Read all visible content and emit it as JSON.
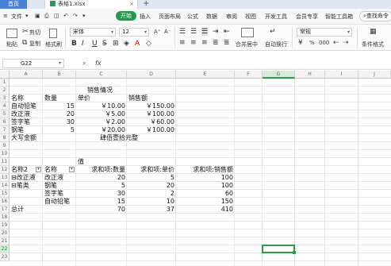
{
  "tabs": {
    "home": "首页",
    "file": "表格1.xlsx",
    "close": "×",
    "new": "+"
  },
  "menu": {
    "file_menu": "文件",
    "items": [
      "开始",
      "插入",
      "页面布局",
      "公式",
      "数据",
      "审阅",
      "视图",
      "开发工具",
      "会员专享",
      "智能工具箱"
    ],
    "search": "查找命令"
  },
  "ribbon": {
    "cut": "剪切",
    "copy": "复制",
    "format_painter": "格式刷",
    "paste": "粘贴",
    "font_name": "宋体",
    "font_size": "12",
    "font_grow": "A⁺",
    "font_shrink": "A⁻",
    "bold": "B",
    "italic": "I",
    "underline": "U",
    "font_color": "A",
    "merge_center": "合并居中",
    "auto_wrap": "自动换行",
    "number_format": "常规",
    "percent": "%",
    "thousands": "000",
    "cond_format": "条件格式"
  },
  "formula": {
    "cell_ref": "G22",
    "fx": "fx",
    "search_icon": "search-icon"
  },
  "columns": [
    "A",
    "B",
    "C",
    "D",
    "E",
    "F",
    "G",
    "H",
    "I",
    "J"
  ],
  "selected_col": "G",
  "rows": [
    "1",
    "2",
    "3",
    "4",
    "5",
    "6",
    "7",
    "8",
    "9",
    "10",
    "11",
    "12",
    "13",
    "14",
    "15",
    "16",
    "17",
    "18",
    "19",
    "20",
    "21",
    "22",
    "23"
  ],
  "selected_row": "22",
  "table1": {
    "title": "销售情况",
    "headers": [
      "名称",
      "数量",
      "单价",
      "销售额"
    ],
    "rows": [
      [
        "自动铅笔",
        "15",
        "￥10.00",
        "￥150.00"
      ],
      [
        "改正液",
        "20",
        "￥5.00",
        "￥100.00"
      ],
      [
        "签字笔",
        "30",
        "￥2.00",
        "￥60.00"
      ],
      [
        "钢笔",
        "5",
        "￥20.00",
        "￥100.00"
      ]
    ],
    "upper_label": "大写金额",
    "upper_value": "肆佰壹拾元整"
  },
  "pivot": {
    "value_label": "值",
    "headers": [
      "名称2",
      "名称",
      "求和项:数量",
      "求和项:单价",
      "求和项:销售额"
    ],
    "rows": [
      [
        "⊟改正液",
        "改正液",
        "20",
        "5",
        "100"
      ],
      [
        "⊟笔类",
        "钢笔",
        "5",
        "20",
        "100"
      ],
      [
        "",
        "签字笔",
        "30",
        "2",
        "60"
      ],
      [
        "",
        "自动铅笔",
        "15",
        "10",
        "150"
      ],
      [
        "总计",
        "",
        "70",
        "37",
        "410"
      ]
    ]
  }
}
